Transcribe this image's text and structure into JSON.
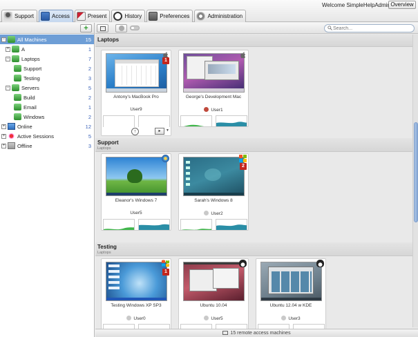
{
  "app": {
    "tabs": [
      {
        "label": "Support",
        "icon": "support-person-icon"
      },
      {
        "label": "Access",
        "icon": "access-computer-icon",
        "active": true
      },
      {
        "label": "Present",
        "icon": "present-projector-icon"
      },
      {
        "label": "History",
        "icon": "history-clock-icon"
      },
      {
        "label": "Preferences",
        "icon": "preferences-screen-icon"
      },
      {
        "label": "Administration",
        "icon": "administration-gear-icon"
      }
    ],
    "welcome": "Welcome SimpleHelpAdmin",
    "overview_label": "Overview"
  },
  "sidebar": {
    "items": [
      {
        "label": "All Machines",
        "count": "15",
        "selected": true
      },
      {
        "label": "A",
        "count": "1"
      },
      {
        "label": "Laptops",
        "count": "7"
      },
      {
        "label": "Support",
        "count": "2"
      },
      {
        "label": "Testing",
        "count": "3"
      },
      {
        "label": "Servers",
        "count": "5"
      },
      {
        "label": "Build",
        "count": "2"
      },
      {
        "label": "Email",
        "count": "1"
      },
      {
        "label": "Windows",
        "count": "2"
      },
      {
        "label": "Online",
        "count": "12"
      },
      {
        "label": "Active Sessions",
        "count": "5"
      },
      {
        "label": "Offline",
        "count": "3"
      }
    ]
  },
  "toolbar": {
    "search_placeholder": "Search..."
  },
  "groups": [
    {
      "title": "Laptops",
      "subtitle": ""
    },
    {
      "title": "Support",
      "subtitle": "Laptops"
    },
    {
      "title": "Testing",
      "subtitle": "Laptops"
    }
  ],
  "machines": [
    {
      "name": "Antony's MacBook Pro",
      "user": "User9",
      "os": "apple",
      "badge": "1",
      "accent": "#1e88d6"
    },
    {
      "name": "George's Development Mac",
      "user": "User1",
      "os": "apple",
      "badge": "",
      "accent": "#7a4b9a"
    },
    {
      "name": "Eleanor's Windows 7",
      "user": "User5",
      "os": "windows-7",
      "badge": "",
      "accent": "#3f9b3a"
    },
    {
      "name": "Sarah's Windows 8",
      "user": "User2",
      "os": "windows-8",
      "badge": "2",
      "accent": "#2a6d86"
    },
    {
      "name": "Testing Windows XP SP3",
      "user": "User0",
      "os": "windows-xp",
      "badge": "1",
      "accent": "#2c74c9"
    },
    {
      "name": "Ubuntu 10.04",
      "user": "User5",
      "os": "linux",
      "badge": "",
      "accent": "#7a2b3a"
    },
    {
      "name": "Ubuntu 12.04 w KDE",
      "user": "User3",
      "os": "linux",
      "badge": "",
      "accent": "#6d7f8c"
    }
  ],
  "status": {
    "text": "15 remote access machines"
  }
}
